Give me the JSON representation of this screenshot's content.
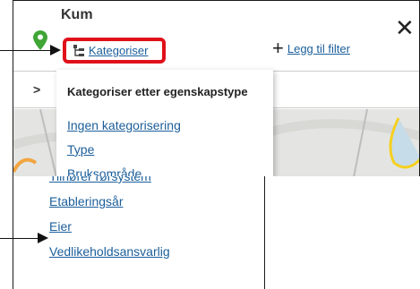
{
  "header": {
    "layer_name": "Kum",
    "categorize_label": "Kategoriser",
    "add_filter_label": "Legg til filter",
    "close_symbol": "✕",
    "expand_symbol": ">"
  },
  "dropdown": {
    "title": "Kategoriser etter egenskapstype",
    "items": [
      "Ingen kategorisering",
      "Type",
      "Bruksområde"
    ]
  },
  "bottom_list": {
    "items": [
      "Tilhører rørsystem",
      "Etableringsår",
      "Eier",
      "Vedlikeholdsansvarlig"
    ]
  },
  "icons": {
    "pin": "map-pin-icon",
    "tree": "hierarchy-tree-icon",
    "plus": "plus-icon",
    "close": "close-icon"
  },
  "colors": {
    "link": "#1b5e9a",
    "highlight": "#e0101a",
    "pin": "#3fa535"
  }
}
